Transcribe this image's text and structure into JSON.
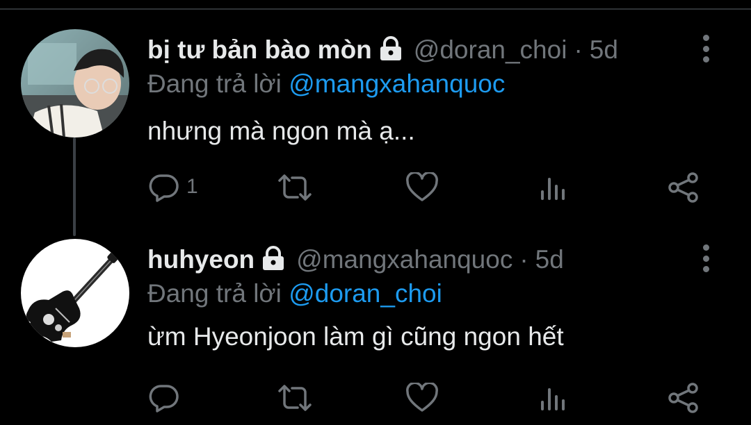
{
  "tweets": [
    {
      "display_name": "bị tư bản bào mòn",
      "handle": "@doran_choi",
      "separator": "·",
      "time": "5d",
      "reply_prefix": "Đang trả lời",
      "reply_mention": "@mangxahanquoc",
      "text": "nhưng mà ngon mà ạ...",
      "reply_count": "1",
      "avatar_icon": "person-photo-avatar",
      "protected": true
    },
    {
      "display_name": "huhyeon",
      "handle": "@mangxahanquoc",
      "separator": "·",
      "time": "5d",
      "reply_prefix": "Đang trả lời",
      "reply_mention": "@doran_choi",
      "text": "ừm Hyeonjoon làm gì cũng ngon hết",
      "reply_count": "",
      "avatar_icon": "guitar-avatar",
      "protected": true
    }
  ],
  "colors": {
    "background": "#000000",
    "text": "#e7e9ea",
    "muted": "#71767b",
    "link": "#1d9bf0",
    "thread_line": "#3b4045"
  },
  "icons": [
    "lock-icon",
    "more-icon",
    "reply-icon",
    "retweet-icon",
    "like-icon",
    "analytics-icon",
    "share-icon"
  ]
}
